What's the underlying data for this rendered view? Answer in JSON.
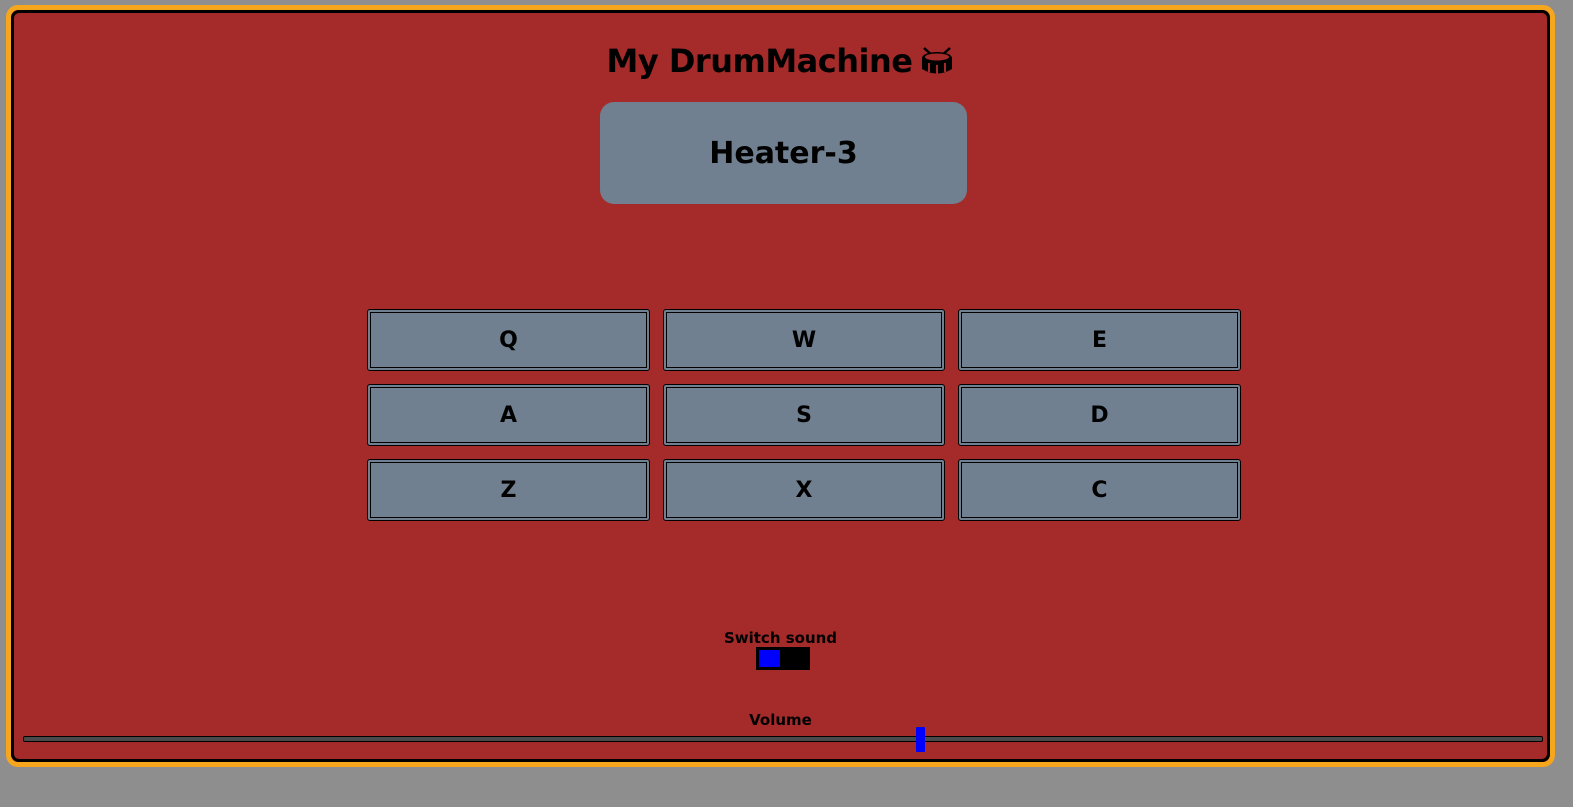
{
  "app": {
    "title": "My DrumMachine"
  },
  "display": {
    "text": "Heater-3"
  },
  "pads": [
    {
      "key": "Q"
    },
    {
      "key": "W"
    },
    {
      "key": "E"
    },
    {
      "key": "A"
    },
    {
      "key": "S"
    },
    {
      "key": "D"
    },
    {
      "key": "Z"
    },
    {
      "key": "X"
    },
    {
      "key": "C"
    }
  ],
  "controls": {
    "switch_label": "Switch sound",
    "switch_state": "left",
    "volume_label": "Volume",
    "volume_fraction": 0.59
  },
  "colors": {
    "frame": "#f5a61d",
    "background": "#a52a2a",
    "pad": "#708090",
    "accent": "#0000ff"
  },
  "icons": {
    "title_icon": "drum-icon"
  }
}
